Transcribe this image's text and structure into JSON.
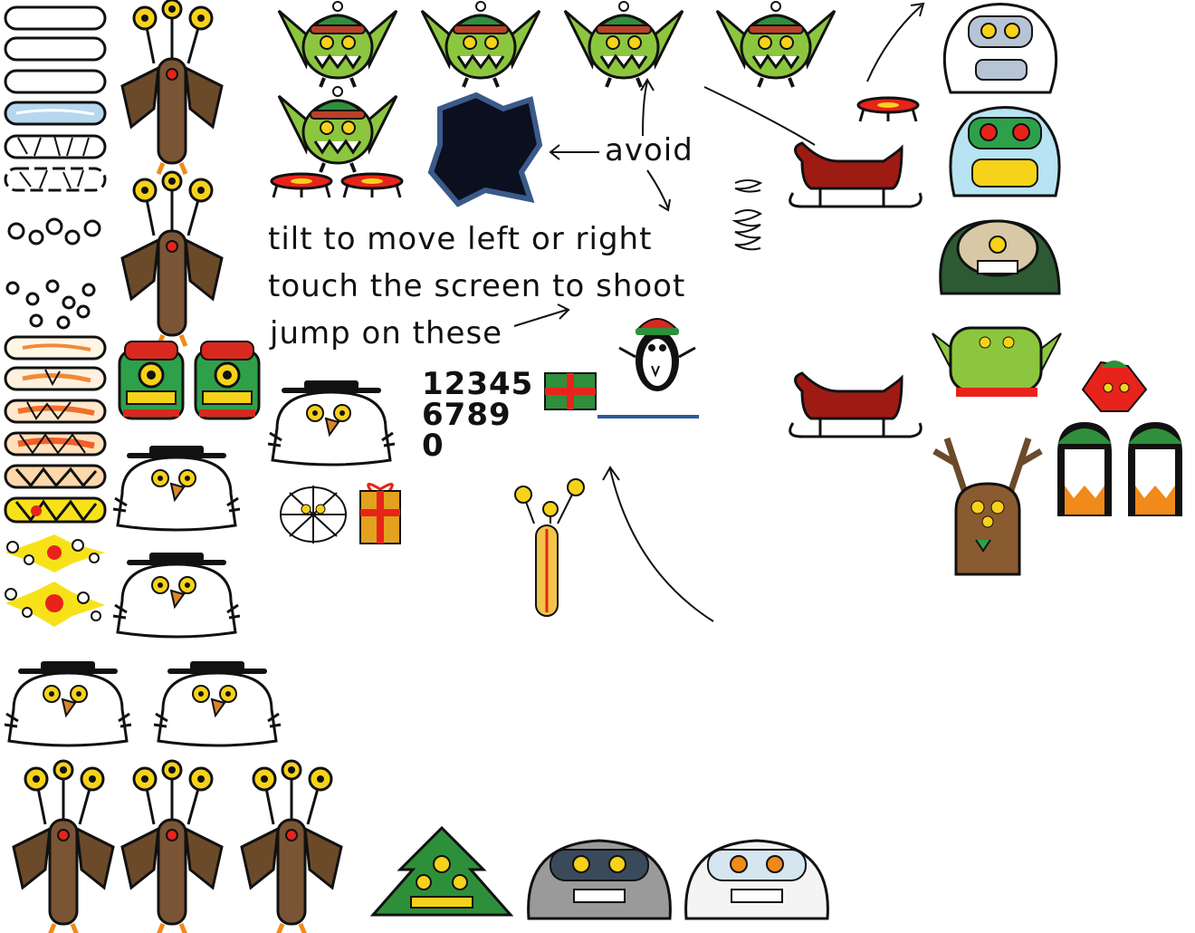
{
  "sheet": {
    "colors": {
      "goblin_green": "#8cc63e",
      "sled_red": "#9e1b14",
      "snow_white": "#ffffff",
      "reindeer_brown": "#6b4a2a",
      "eye_yellow": "#f6d21a",
      "gift_green": "#2f8f3a",
      "gift_gold": "#e2a21f",
      "hole_dark": "#0b0f1f",
      "ice_blue": "#b7d7ee",
      "tree_green": "#2e8f3b",
      "yeti_grey": "#9a9a9a"
    },
    "instructions": {
      "avoid": "avoid",
      "tilt": "tilt to move left or right",
      "touch": "touch the screen to shoot",
      "jump": "jump on these"
    },
    "digits": {
      "row1": "12345",
      "row2": "6789",
      "row3": "0"
    },
    "icons": [
      "platform-plain",
      "platform-ice",
      "platform-breaking",
      "platform-snowball",
      "platform-exploding",
      "reindeer-monster",
      "goblin-elf",
      "black-hole",
      "trampoline",
      "spring",
      "sled",
      "yeti",
      "snowman-monster",
      "penguin",
      "gift-box",
      "christmas-tree-monster",
      "snowflake-monster"
    ]
  }
}
